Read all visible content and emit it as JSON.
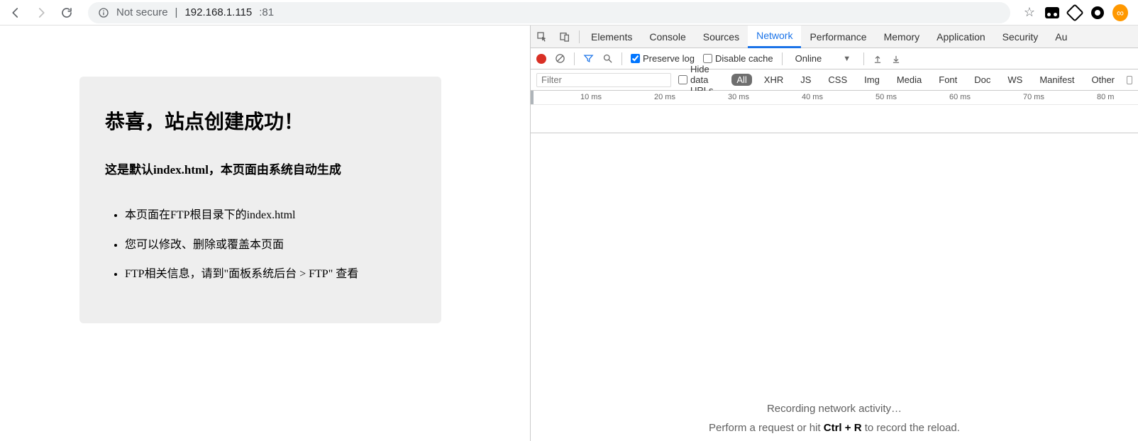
{
  "browser": {
    "not_secure": "Not secure",
    "url_host": "192.168.1.115",
    "url_port": ":81"
  },
  "page": {
    "heading": "恭喜，站点创建成功！",
    "subtitle": "这是默认index.html，本页面由系统自动生成",
    "bullets": [
      "本页面在FTP根目录下的index.html",
      "您可以修改、删除或覆盖本页面",
      "FTP相关信息，请到\"面板系统后台 > FTP\"  查看"
    ]
  },
  "devtools": {
    "tabs": [
      "Elements",
      "Console",
      "Sources",
      "Network",
      "Performance",
      "Memory",
      "Application",
      "Security",
      "Au"
    ],
    "active_tab": "Network",
    "toolbar": {
      "preserve_log": "Preserve log",
      "disable_cache": "Disable cache",
      "throttle": "Online"
    },
    "filter": {
      "placeholder": "Filter",
      "hide_label": "Hide data URLs",
      "types": [
        "All",
        "XHR",
        "JS",
        "CSS",
        "Img",
        "Media",
        "Font",
        "Doc",
        "WS",
        "Manifest",
        "Other"
      ],
      "active_type": "All"
    },
    "timeline_ticks": [
      "10 ms",
      "20 ms",
      "30 ms",
      "40 ms",
      "50 ms",
      "60 ms",
      "70 ms",
      "80 m"
    ],
    "empty": {
      "line1": "Recording network activity…",
      "line2_a": "Perform a request or hit ",
      "line2_b": "Ctrl + R",
      "line2_c": " to record the reload."
    }
  }
}
